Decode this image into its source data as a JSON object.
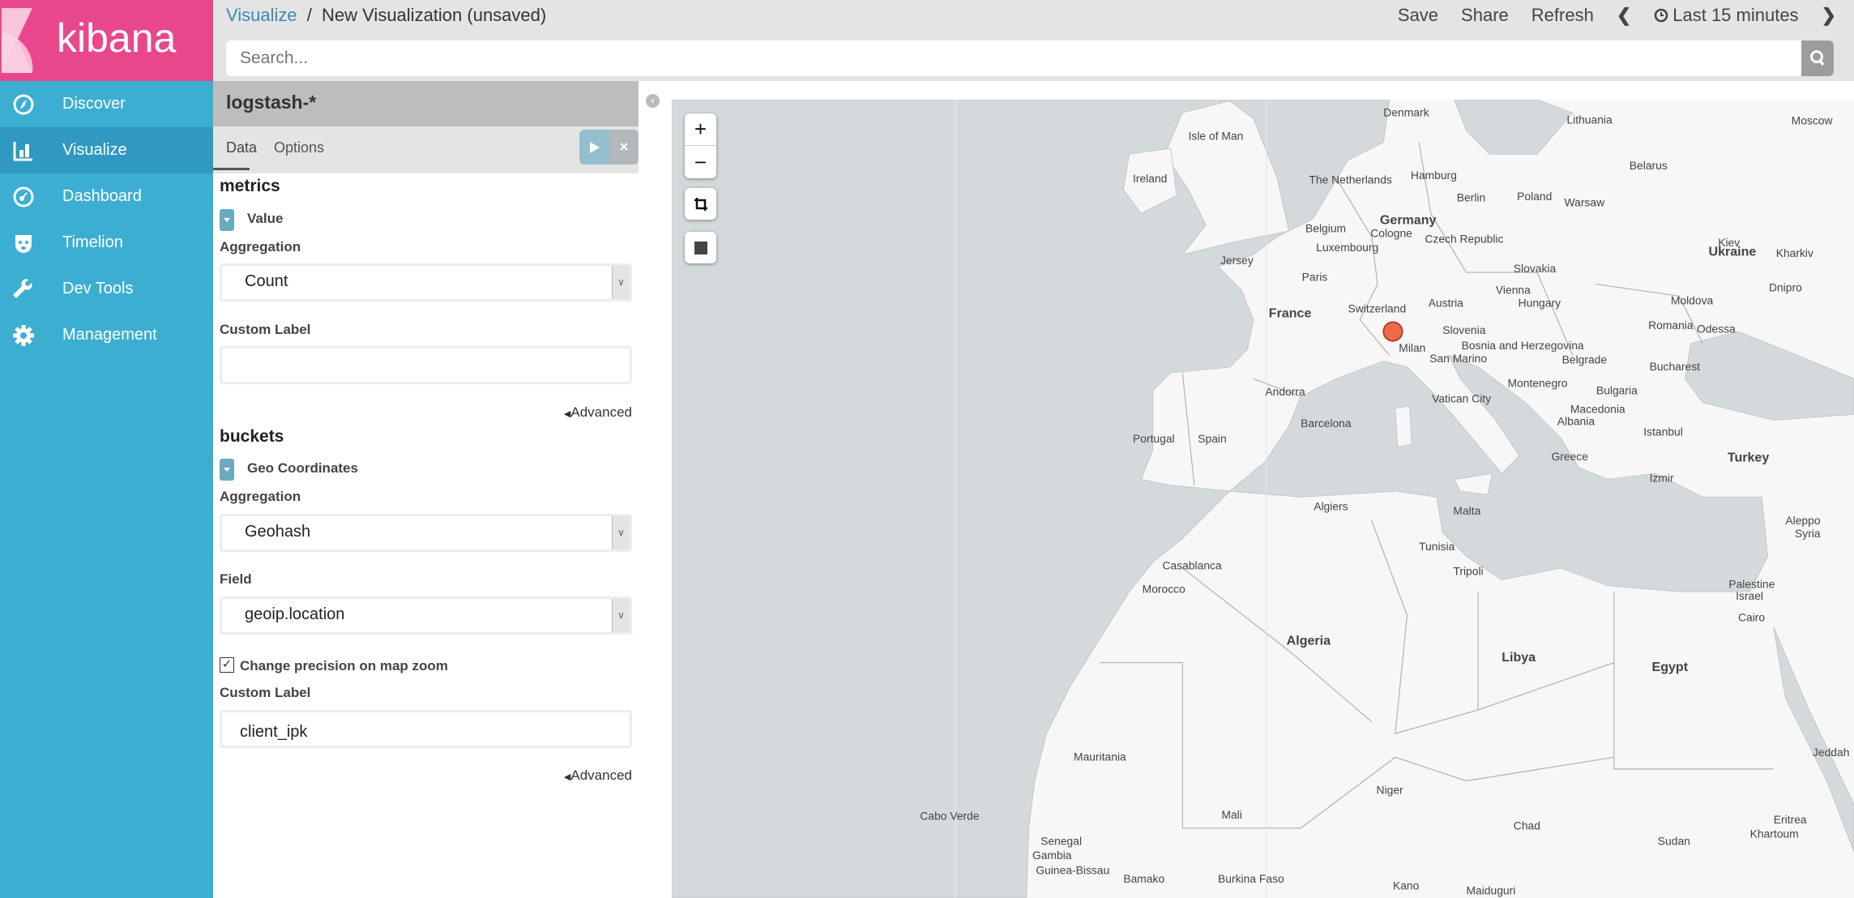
{
  "brand": {
    "name": "kibana",
    "color": "#e8488b"
  },
  "sidebar": {
    "items": [
      {
        "label": "Discover",
        "icon": "compass-icon"
      },
      {
        "label": "Visualize",
        "icon": "bar-chart-icon",
        "active": true
      },
      {
        "label": "Dashboard",
        "icon": "dashboard-gauge-icon"
      },
      {
        "label": "Timelion",
        "icon": "timelion-bear-icon"
      },
      {
        "label": "Dev Tools",
        "icon": "wrench-icon"
      },
      {
        "label": "Management",
        "icon": "gear-icon"
      }
    ]
  },
  "header": {
    "breadcrumb_link": "Visualize",
    "separator": "/",
    "title": "New Visualization (unsaved)",
    "save": "Save",
    "share": "Share",
    "refresh": "Refresh",
    "time": "Last 15 minutes"
  },
  "search": {
    "placeholder": "Search..."
  },
  "panel": {
    "index": "logstash-*",
    "tabs": [
      "Data",
      "Options"
    ],
    "close": "×",
    "metrics": {
      "heading": "metrics",
      "agg_title": "Value",
      "aggregation_label": "Aggregation",
      "aggregation": "Count",
      "custom_label_label": "Custom Label",
      "custom_label": "",
      "advanced": "Advanced"
    },
    "buckets": {
      "heading": "buckets",
      "agg_title": "Geo Coordinates",
      "aggregation_label": "Aggregation",
      "aggregation": "Geohash",
      "field_label": "Field",
      "field": "geoip.location",
      "precision_label": "Change precision on map zoom",
      "precision_checked": true,
      "custom_label_label": "Custom Label",
      "custom_label": "client_ipk",
      "advanced": "Advanced"
    }
  },
  "map": {
    "zoom_in": "+",
    "zoom_out": "−",
    "colors": {
      "sea": "#d4dadc",
      "land": "#f7f7f7",
      "marker": "#ee6a4a"
    },
    "labels": [
      "Denmark",
      "Lithuania",
      "Moscow",
      "Isle of Man",
      "Hamburg",
      "Belarus",
      "Ireland",
      "The Netherlands",
      "Berlin",
      "Poland",
      "Warsaw",
      "Germany",
      "Belgium",
      "Cologne",
      "Czech Republic",
      "Slovakia",
      "Kiev",
      "Ukraine",
      "Kharkiv",
      "Luxembourg",
      "Jersey",
      "Paris",
      "Vienna",
      "Hungary",
      "Dnipro",
      "Austria",
      "Switzerland",
      "Moldova",
      "France",
      "Slovenia",
      "Romania",
      "Odessa",
      "Milan",
      "Bosnia and Herzegovina",
      "San Marino",
      "Belgrade",
      "Bucharest",
      "Montenegro",
      "Andorra",
      "Vatican City",
      "Macedonia",
      "Bulgaria",
      "Albania",
      "Barcelona",
      "Portugal",
      "Spain",
      "Istanbul",
      "Turkey",
      "Greece",
      "Izmir",
      "Algiers",
      "Malta",
      "Tunisia",
      "Tripoli",
      "Aleppo",
      "Syria",
      "Casablanca",
      "Morocco",
      "Palestine",
      "Israel",
      "Cairo",
      "Algeria",
      "Libya",
      "Egypt",
      "Mauritania",
      "Mali",
      "Niger",
      "Chad",
      "Cabo Verde",
      "Senegal",
      "Gambia",
      "Guinea-Bissau",
      "Bamako",
      "Burkina Faso",
      "Kano",
      "Maiduguri",
      "Eritrea",
      "Sudan",
      "Khartoum",
      "Jeddah"
    ]
  }
}
